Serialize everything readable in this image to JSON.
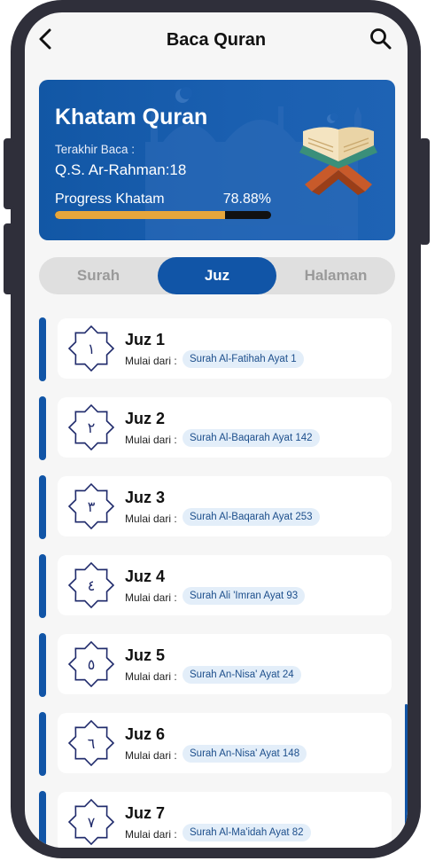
{
  "header": {
    "title": "Baca Quran",
    "back_icon": "chevron-left-icon",
    "search_icon": "search-icon"
  },
  "hero": {
    "title": "Khatam Quran",
    "last_read_label": "Terakhir Baca :",
    "last_read_value": "Q.S. Ar-Rahman:18",
    "progress_label": "Progress Khatam",
    "progress_percent": "78.88%",
    "progress_value": 0.7888,
    "progress_color": "#e6a63c",
    "card_color": "#1257a5"
  },
  "tabs": [
    {
      "label": "Surah",
      "active": false
    },
    {
      "label": "Juz",
      "active": true
    },
    {
      "label": "Halaman",
      "active": false
    }
  ],
  "list": {
    "mulai_label": "Mulai dari :",
    "items": [
      {
        "title": "Juz 1",
        "number": "١",
        "start": "Surah Al-Fatihah Ayat 1"
      },
      {
        "title": "Juz 2",
        "number": "٢",
        "start": "Surah Al-Baqarah Ayat 142"
      },
      {
        "title": "Juz 3",
        "number": "٣",
        "start": "Surah Al-Baqarah Ayat 253"
      },
      {
        "title": "Juz 4",
        "number": "٤",
        "start": "Surah Ali 'Imran Ayat 93"
      },
      {
        "title": "Juz 5",
        "number": "٥",
        "start": "Surah An-Nisa' Ayat 24"
      },
      {
        "title": "Juz 6",
        "number": "٦",
        "start": "Surah An-Nisa' Ayat 148"
      },
      {
        "title": "Juz 7",
        "number": "٧",
        "start": "Surah Al-Ma'idah Ayat 82"
      }
    ]
  },
  "colors": {
    "primary": "#1155a7",
    "chip_bg": "#e3eef9",
    "chip_text": "#1d4f8c"
  }
}
